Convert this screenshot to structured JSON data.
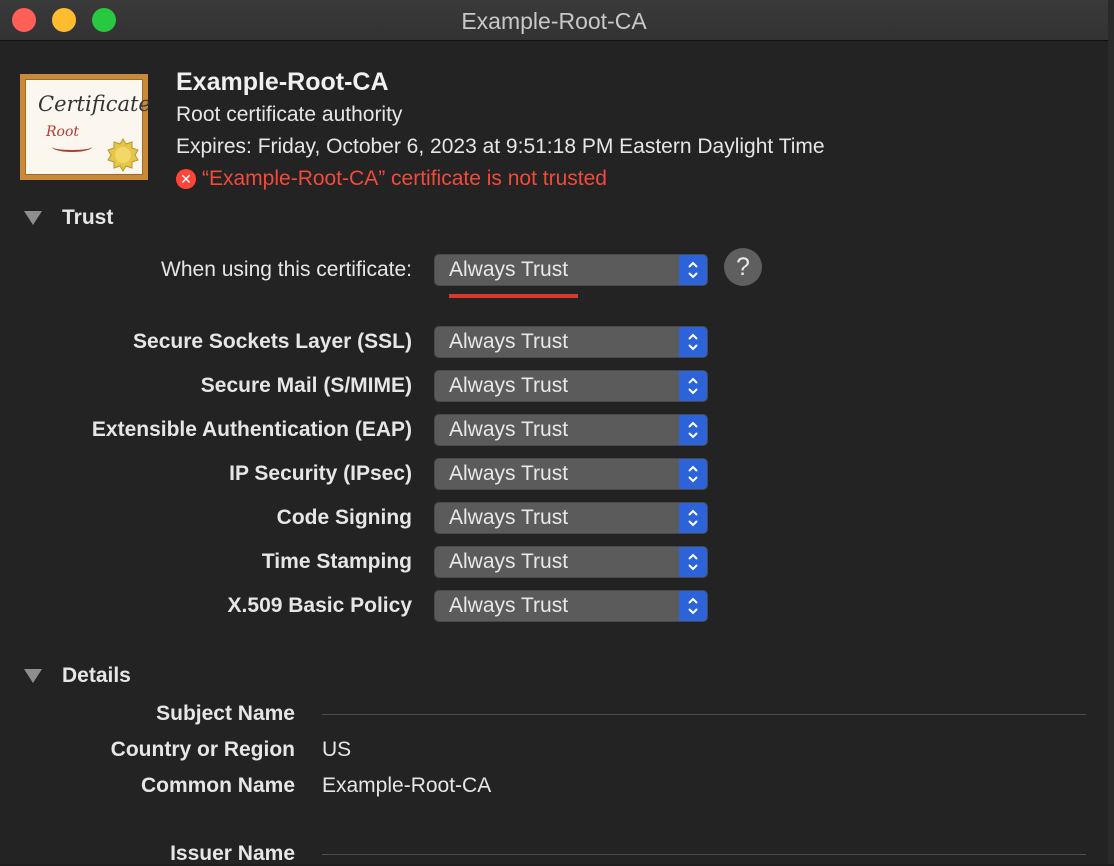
{
  "window": {
    "title": "Example-Root-CA"
  },
  "certificate": {
    "image_word": "Certificate",
    "image_sub": "Root",
    "name": "Example-Root-CA",
    "kind": "Root certificate authority",
    "expires": "Expires: Friday, October 6, 2023 at 9:51:18 PM Eastern Daylight Time",
    "warning": "“Example-Root-CA” certificate is not trusted",
    "warning_color": "#f24a3b"
  },
  "trust": {
    "title": "Trust",
    "when_using_label": "When using this certificate:",
    "when_using_value": "Always Trust",
    "help_label": "?",
    "policies": [
      {
        "label": "Secure Sockets Layer (SSL)",
        "value": "Always Trust"
      },
      {
        "label": "Secure Mail (S/MIME)",
        "value": "Always Trust"
      },
      {
        "label": "Extensible Authentication (EAP)",
        "value": "Always Trust"
      },
      {
        "label": "IP Security (IPsec)",
        "value": "Always Trust"
      },
      {
        "label": "Code Signing",
        "value": "Always Trust"
      },
      {
        "label": "Time Stamping",
        "value": "Always Trust"
      },
      {
        "label": "X.509 Basic Policy",
        "value": "Always Trust"
      }
    ]
  },
  "details": {
    "title": "Details",
    "subject_name_label": "Subject Name",
    "country_label": "Country or Region",
    "country_value": "US",
    "common_name_label": "Common Name",
    "common_name_value": "Example-Root-CA",
    "issuer_name_label": "Issuer Name"
  },
  "colors": {
    "accent": "#2c63d8",
    "error": "#ff453a"
  }
}
